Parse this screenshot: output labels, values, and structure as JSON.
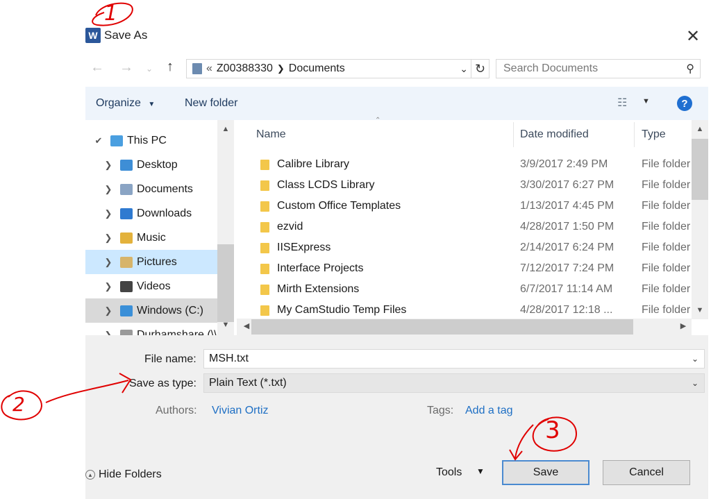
{
  "window": {
    "title": "Save As",
    "app_icon": "word-icon"
  },
  "nav": {
    "path_prefix": "«",
    "path_segments": [
      "Z00388330",
      "Documents"
    ],
    "search_placeholder": "Search Documents"
  },
  "toolbar": {
    "organize": "Organize",
    "new_folder": "New folder",
    "help": "?"
  },
  "sidebar": {
    "items": [
      {
        "label": "This PC",
        "expanded": true
      },
      {
        "label": "Desktop"
      },
      {
        "label": "Documents"
      },
      {
        "label": "Downloads"
      },
      {
        "label": "Music"
      },
      {
        "label": "Pictures"
      },
      {
        "label": "Videos"
      },
      {
        "label": "Windows (C:)"
      },
      {
        "label": "Durhamshare (\\\\"
      }
    ]
  },
  "list": {
    "columns": [
      "Name",
      "Date modified",
      "Type"
    ],
    "rows": [
      {
        "name": "Calibre Library",
        "date": "3/9/2017 2:49 PM",
        "type": "File folder"
      },
      {
        "name": "Class LCDS Library",
        "date": "3/30/2017 6:27 PM",
        "type": "File folder"
      },
      {
        "name": "Custom Office Templates",
        "date": "1/13/2017 4:45 PM",
        "type": "File folder"
      },
      {
        "name": "ezvid",
        "date": "4/28/2017 1:50 PM",
        "type": "File folder"
      },
      {
        "name": "IISExpress",
        "date": "2/14/2017 6:24 PM",
        "type": "File folder"
      },
      {
        "name": "Interface Projects",
        "date": "7/12/2017 7:24 PM",
        "type": "File folder"
      },
      {
        "name": "Mirth Extensions",
        "date": "6/7/2017 11:14 AM",
        "type": "File folder"
      },
      {
        "name": "My CamStudio Temp Files",
        "date": "4/28/2017 12:18 ...",
        "type": "File folder"
      }
    ]
  },
  "form": {
    "file_name_label": "File name:",
    "file_name_value": "MSH.txt",
    "save_type_label": "Save as type:",
    "save_type_value": "Plain Text (*.txt)",
    "authors_label": "Authors:",
    "authors_value": "Vivian Ortiz",
    "tags_label": "Tags:",
    "tags_value": "Add a tag"
  },
  "footer": {
    "hide_folders": "Hide Folders",
    "tools": "Tools",
    "save": "Save",
    "cancel": "Cancel"
  },
  "annotations": {
    "one": "1",
    "two": "2",
    "three": "3"
  }
}
